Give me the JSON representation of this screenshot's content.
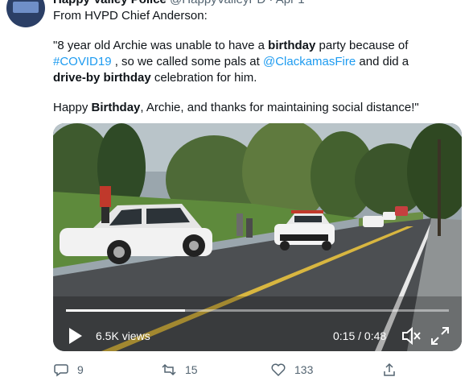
{
  "tweet": {
    "author_name": "Happy Valley Police",
    "author_handle": "@HappyValleyPD",
    "date": "Apr 1",
    "line1": "From HVPD Chief Anderson:",
    "line2_a": "\"8 year old Archie was unable to have a ",
    "line2_b": "birthday",
    "line2_c": " party because of",
    "line3_hashtag": "#COVID19",
    "line3_b": " , so we called some pals at ",
    "line3_mention": "@ClackamasFire",
    "line3_d": " and did a",
    "line4_a": "drive-by birthday",
    "line4_b": " celebration for him.",
    "line5_a": "Happy ",
    "line5_b": "Birthday",
    "line5_c": ", Archie, and thanks for maintaining social distance!\""
  },
  "video": {
    "views": "6.5K views",
    "time": "0:15 / 0:48",
    "progress": 0.31
  },
  "actions": {
    "replies": "9",
    "retweets": "15",
    "likes": "133"
  },
  "colors": {
    "link": "#1d9bf0",
    "muted": "#536471"
  }
}
